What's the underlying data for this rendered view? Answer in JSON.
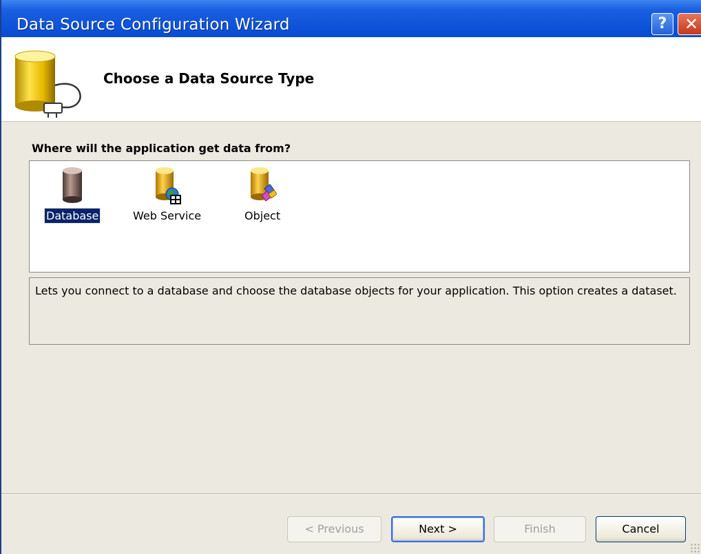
{
  "window": {
    "title": "Data Source Configuration Wizard",
    "help_glyph": "?",
    "close_glyph": "✕"
  },
  "header": {
    "heading": "Choose a Data Source Type",
    "icon": "database-plug-icon"
  },
  "question": "Where will the application get data from?",
  "options": [
    {
      "label": "Database",
      "icon": "database-icon",
      "selected": true
    },
    {
      "label": "Web Service",
      "icon": "web-service-icon",
      "selected": false
    },
    {
      "label": "Object",
      "icon": "object-icon",
      "selected": false
    }
  ],
  "description": "Lets you connect to a database and choose the database objects for your application. This option creates a dataset.",
  "buttons": {
    "previous": "< Previous",
    "next": "Next >",
    "finish": "Finish",
    "cancel": "Cancel"
  },
  "colors": {
    "titlebar": "#0a4fd6",
    "selection": "#0a246a",
    "dialog_bg": "#ece9e0"
  }
}
